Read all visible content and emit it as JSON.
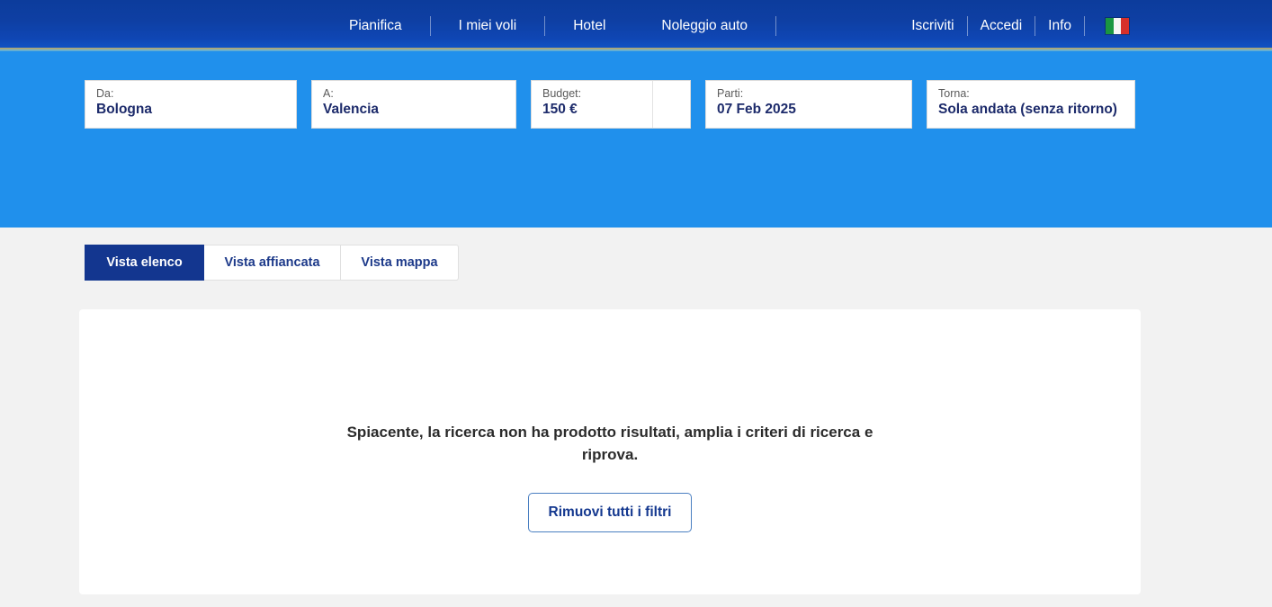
{
  "header": {
    "nav_left": [
      {
        "label": "Pianifica",
        "name": "nav-pianifica"
      },
      {
        "label": "I miei voli",
        "name": "nav-i-miei-voli"
      },
      {
        "label": "Hotel",
        "name": "nav-hotel"
      },
      {
        "label": "Noleggio auto",
        "name": "nav-noleggio-auto"
      }
    ],
    "nav_right": [
      {
        "label": "Iscriviti",
        "name": "nav-iscriviti"
      },
      {
        "label": "Accedi",
        "name": "nav-accedi"
      },
      {
        "label": "Info",
        "name": "nav-info"
      }
    ],
    "flag_icon": "italy-flag-icon",
    "flag_colors": [
      "#1a9641",
      "#f5f5f5",
      "#d6302b"
    ],
    "background_color": "#0e3fa3"
  },
  "search": {
    "background_color": "#2090ec",
    "fields": [
      {
        "label": "Da:",
        "value": "Bologna",
        "name": "origin-field"
      },
      {
        "label": "A:",
        "value": "Valencia",
        "name": "destination-field"
      },
      {
        "label": "Budget:",
        "value": "150 €",
        "name": "budget-field"
      },
      {
        "label": "Parti:",
        "value": "07 Feb 2025",
        "name": "depart-date-field"
      },
      {
        "label": "Torna:",
        "value": "Sola andata (senza ritorno)",
        "name": "return-date-field"
      }
    ]
  },
  "view_tabs": {
    "items": [
      {
        "label": "Vista elenco",
        "active": true
      },
      {
        "label": "Vista affiancata",
        "active": false
      },
      {
        "label": "Vista mappa",
        "active": false
      }
    ],
    "active_color": "#13368f"
  },
  "results": {
    "empty_message": "Spiacente, la ricerca non ha prodotto risultati, amplia i criteri di ricerca e riprova.",
    "clear_filters_label": "Rimuovi tutti i filtri",
    "accent_color": "#14388f"
  }
}
